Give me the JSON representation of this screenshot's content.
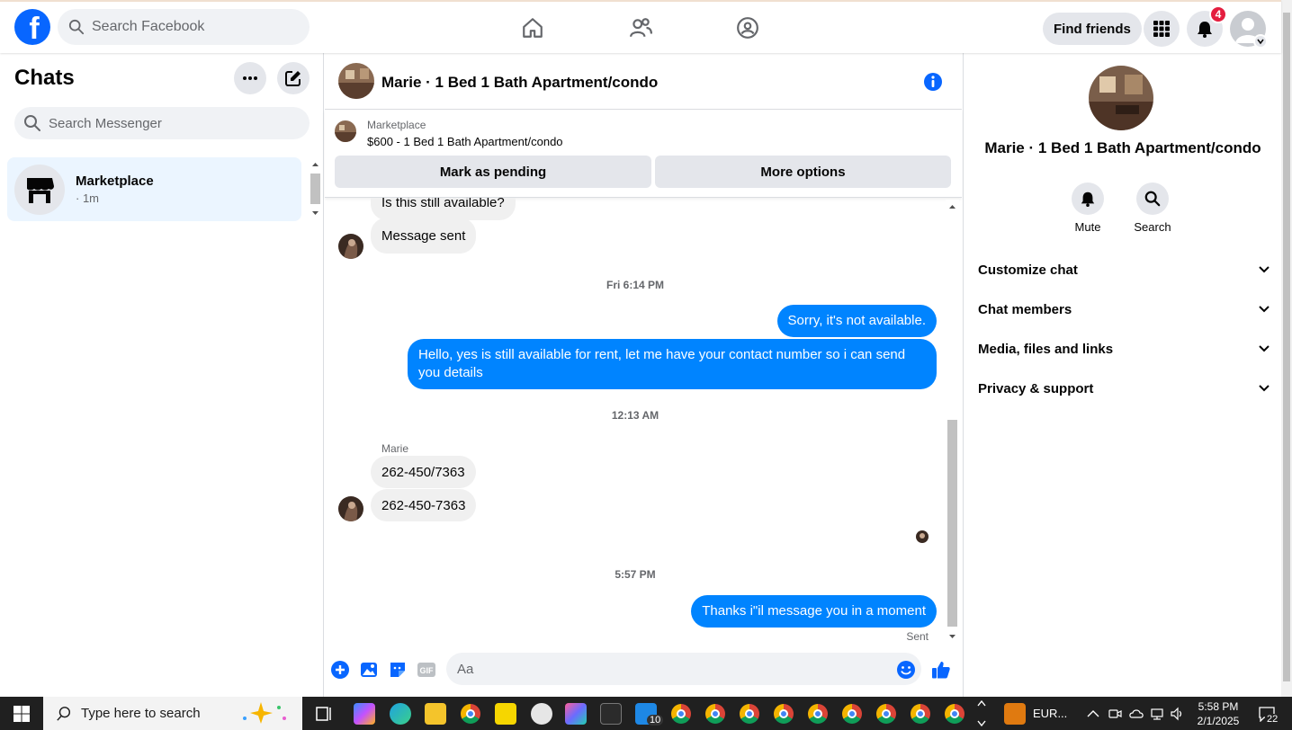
{
  "topbar": {
    "search_placeholder": "Search Facebook",
    "find_friends": "Find friends",
    "notification_count": "4",
    "icons": [
      "home-icon",
      "friends-icon",
      "groups-icon",
      "menu-grid-icon",
      "bell-icon",
      "account-avatar"
    ]
  },
  "left": {
    "title": "Chats",
    "search_placeholder": "Search Messenger",
    "chats": [
      {
        "name": "Marketplace",
        "meta": "· 1m"
      }
    ]
  },
  "conversation": {
    "title": "Marie · 1 Bed 1 Bath Apartment/condo",
    "banner": {
      "label": "Marketplace",
      "listing": "$600 - 1 Bed 1 Bath Apartment/condo",
      "mark_pending": "Mark as pending",
      "more_options": "More options"
    },
    "messages": {
      "in_1": "Is this still available?",
      "in_2": "Message sent",
      "time_1": "Fri 6:14 PM",
      "out_1": "Sorry, it's not available.",
      "out_2": "Hello, yes  is still available for rent, let me have your contact number so i can send you details",
      "time_2": "12:13 AM",
      "sender": "Marie",
      "in_3": "262-450/7363",
      "in_4": "262-450-7363",
      "time_3": "5:57 PM",
      "out_3": "Thanks i\"il message you in a moment",
      "status": "Sent"
    },
    "composer_placeholder": "Aa"
  },
  "right": {
    "title": "Marie · 1 Bed 1 Bath Apartment/condo",
    "actions": {
      "mute": "Mute",
      "search": "Search"
    },
    "sections": [
      "Customize chat",
      "Chat members",
      "Media, files and links",
      "Privacy & support"
    ]
  },
  "taskbar": {
    "search_placeholder": "Type here to search",
    "badge_count": "10",
    "widget_text": "EUR...",
    "time": "5:58 PM",
    "date": "2/1/2025",
    "notification_count": "22"
  },
  "colors": {
    "brand": "#0866ff",
    "outgoing_bubble": "#0084ff",
    "notification": "#e41e3f"
  }
}
